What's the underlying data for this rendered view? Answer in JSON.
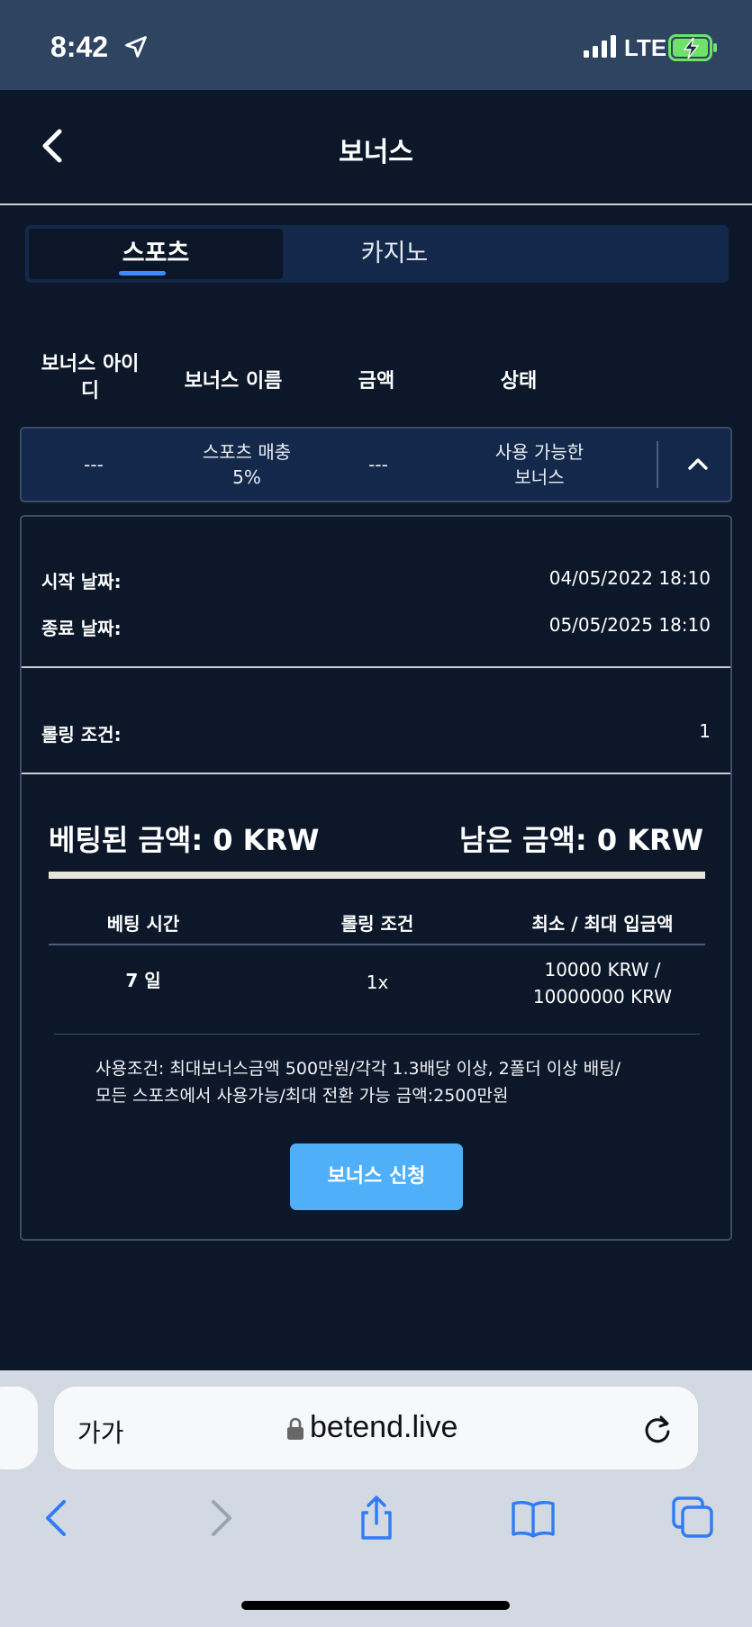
{
  "status_bar": {
    "time": "8:42",
    "network": "LTE",
    "battery_icon": "battery-charging-icon"
  },
  "header": {
    "title": "보너스",
    "back_icon": "chevron-left-icon"
  },
  "tabs": [
    {
      "label": "스포츠",
      "active": true
    },
    {
      "label": "카지노",
      "active": false
    }
  ],
  "columns": {
    "id": "보너스 아이디",
    "name": "보너스 이름",
    "amount": "금액",
    "status": "상태"
  },
  "bonus_row": {
    "id": "---",
    "name_line1": "스포츠 매충",
    "name_line2": "5%",
    "amount": "---",
    "status_line1": "사용 가능한",
    "status_line2": "보너스",
    "toggle_icon": "chevron-up-icon"
  },
  "details": {
    "start_label": "시작 날짜:",
    "start_value": "04/05/2022 18:10",
    "end_label": "종료 날짜:",
    "end_value": "05/05/2025 18:10",
    "rolling_label": "롤링 조건:",
    "rolling_value": "1"
  },
  "amounts": {
    "bet_amount": "베팅된 금액: 0 KRW",
    "remaining_amount": "남은 금액: 0 KRW",
    "progress_percent": 0
  },
  "terms_table": {
    "headers": [
      "베팅 시간",
      "롤링 조건",
      "최소 / 최대 입금액"
    ],
    "row": {
      "bet_time": "7 일",
      "rolling": "1x",
      "deposit_line1": "10000 KRW /",
      "deposit_line2": "10000000 KRW"
    }
  },
  "conditions": {
    "line1": "사용조건: 최대보너스금액 500만원/각각 1.3배당 이상, 2폴더 이상 배팅/",
    "line2": "모든 스포츠에서 사용가능/최대 전환 가능 금액:2500만원"
  },
  "apply_button": "보너스 신청",
  "browser": {
    "text_size_label": "가가",
    "url": "betend.live",
    "accent": "#2f7cf6"
  },
  "colors": {
    "background": "#0c1729",
    "panel": "#13284a",
    "button": "#4faff8",
    "tab_underline": "#3d8bff"
  }
}
